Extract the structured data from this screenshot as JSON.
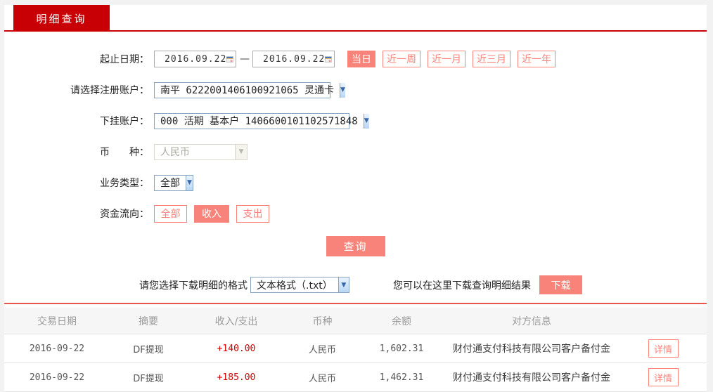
{
  "tab": {
    "label": "明细查询"
  },
  "form": {
    "date_label": "起止日期：",
    "date_start": "2016.09.22",
    "date_end": "2016.09.22",
    "date_separator": "—",
    "quick_buttons": [
      {
        "label": "当日",
        "active": true
      },
      {
        "label": "近一周",
        "active": false
      },
      {
        "label": "近一月",
        "active": false
      },
      {
        "label": "近三月",
        "active": false
      },
      {
        "label": "近一年",
        "active": false
      }
    ],
    "register_account_label": "请选择注册账户：",
    "register_account_value": "南平 6222001406100921065 灵通卡",
    "sub_account_label": "下挂账户：",
    "sub_account_value": "000 活期 基本户 1406600101102571848",
    "currency_label": "币　　种：",
    "currency_value": "人民币",
    "currency_disabled": true,
    "business_type_label": "业务类型：",
    "business_type_value": "全部",
    "flow_label": "资金流向：",
    "flow_buttons": [
      {
        "label": "全部",
        "active": false
      },
      {
        "label": "收入",
        "active": true
      },
      {
        "label": "支出",
        "active": false
      }
    ],
    "query_button": "查询"
  },
  "download": {
    "format_label": "请您选择下载明细的格式",
    "format_value": "文本格式（.txt）",
    "hint": "您可以在这里下载查询明细结果",
    "button": "下载"
  },
  "table": {
    "headers": [
      "交易日期",
      "摘要",
      "收入/支出",
      "币种",
      "余额",
      "对方信息"
    ],
    "rows": [
      {
        "date": "2016-09-22",
        "summary": "DF提现",
        "amount": "+140.00",
        "currency": "人民币",
        "balance": "1,602.31",
        "counterparty": "财付通支付科技有限公司客户备付金",
        "detail_button": "详情"
      },
      {
        "date": "2016-09-22",
        "summary": "DF提现",
        "amount": "+185.00",
        "currency": "人民币",
        "balance": "1,462.31",
        "counterparty": "财付通支付科技有限公司客户备付金",
        "detail_button": "详情"
      }
    ]
  },
  "colors": {
    "brand_red": "#c80005",
    "salmon": "#f8837b",
    "table_topline": "#e8584e",
    "amount_red": "#d40000"
  }
}
